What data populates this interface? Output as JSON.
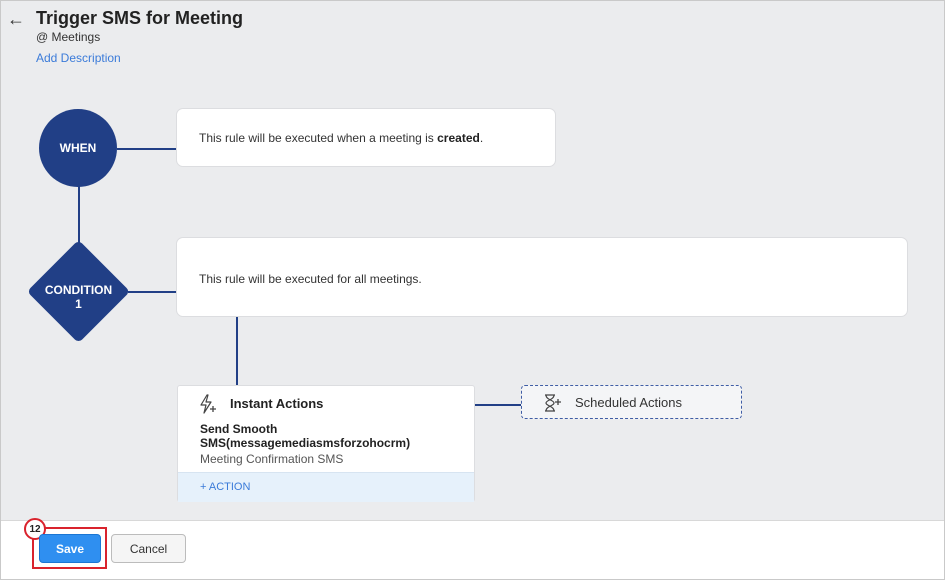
{
  "header": {
    "back_glyph": "←",
    "title": "Trigger SMS for Meeting",
    "module": "@ Meetings",
    "add_description": "Add Description"
  },
  "when": {
    "node_label": "WHEN",
    "text_prefix": "This rule will be executed when a meeting is ",
    "text_bold": "created",
    "text_suffix": "."
  },
  "condition": {
    "node_label_line1": "CONDITION",
    "node_label_line2": "1",
    "text": "This rule will be executed for all meetings."
  },
  "instant_actions": {
    "icon": "lightning-plus-icon",
    "title": "Instant Actions",
    "action_name": "Send Smooth SMS(messagemediasmsforzohocrm)",
    "action_subtitle": "Meeting Confirmation SMS",
    "add_action": "+ ACTION"
  },
  "scheduled_actions": {
    "icon": "hourglass-plus-icon",
    "label": "Scheduled Actions"
  },
  "footer": {
    "step_number": "12",
    "save_label": "Save",
    "cancel_label": "Cancel"
  },
  "colors": {
    "node_blue": "#213f86",
    "link_blue": "#3b7bd9",
    "save_blue": "#2f8ff0",
    "highlight_red": "#d9232d"
  }
}
